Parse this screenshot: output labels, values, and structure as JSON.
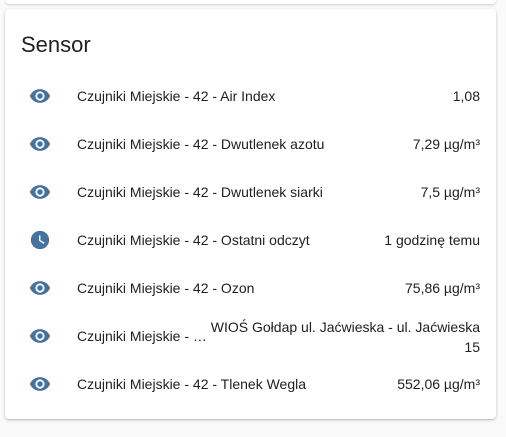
{
  "card": {
    "title": "Sensor"
  },
  "colors": {
    "icon": "#44739e"
  },
  "rows": [
    {
      "icon": "eye-icon",
      "name": "Czujniki Miejskie - 42 - Air Index",
      "value": "1,08"
    },
    {
      "icon": "eye-icon",
      "name": "Czujniki Miejskie - 42 - Dwutlenek azotu",
      "value": "7,29 µg/m³"
    },
    {
      "icon": "eye-icon",
      "name": "Czujniki Miejskie - 42 - Dwutlenek siarki",
      "value": "7,5 µg/m³"
    },
    {
      "icon": "clock-icon",
      "name": "Czujniki Miejskie - 42 - Ostatni odczyt",
      "value": "1 godzinę temu"
    },
    {
      "icon": "eye-icon",
      "name": "Czujniki Miejskie - 42 - Ozon",
      "value": "75,86 µg/m³"
    },
    {
      "icon": "eye-icon",
      "name": "Czujniki Miejskie - …",
      "value": "WIOŚ Gołdap ul. Jaćwieska - ul. Jaćwieska 15"
    },
    {
      "icon": "eye-icon",
      "name": "Czujniki Miejskie - 42 - Tlenek Wegla",
      "value": "552,06 µg/m³"
    }
  ]
}
